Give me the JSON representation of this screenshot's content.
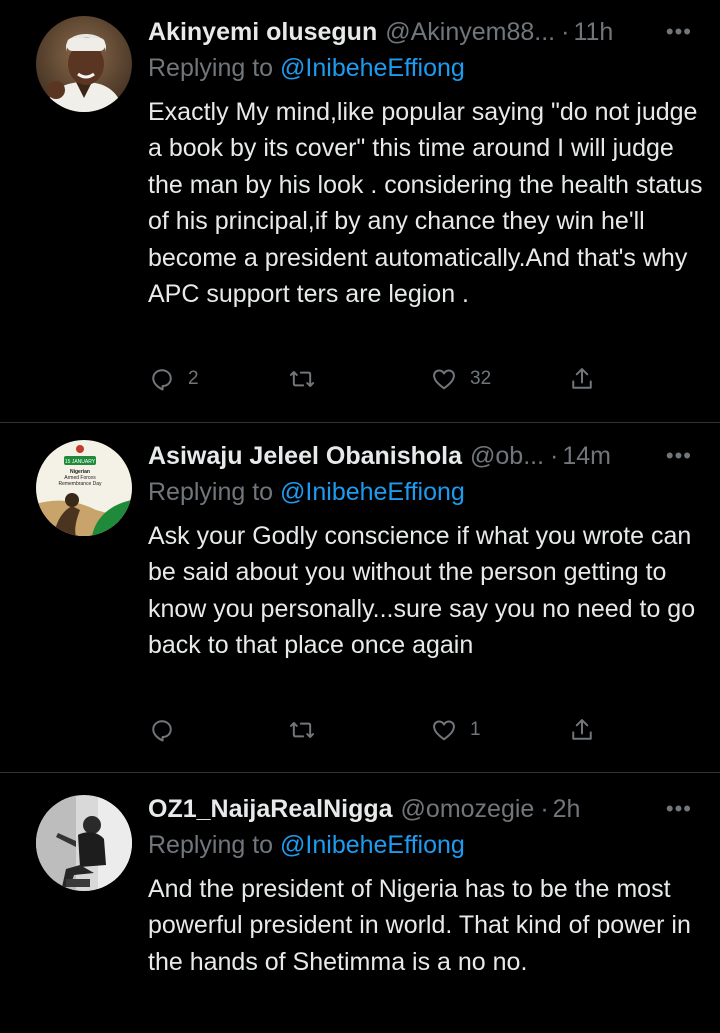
{
  "colors": {
    "background": "#000000",
    "text": "#e7e9ea",
    "muted": "#71767b",
    "link": "#1d9bf0",
    "divider": "#2f3336"
  },
  "tweets": [
    {
      "name": "Akinyemi olusegun",
      "handle": "@Akinyem88...",
      "separator": "·",
      "time": "11h",
      "replying_prefix": "Replying to",
      "replying_to": "@InibeheEffiong",
      "text": "Exactly My mind,like popular saying \"do not judge a book by its cover\" this time around I will judge the man by his look . considering the health status of his principal,if by any chance they win he'll become a president automatically.And that's why APC support ters are legion .",
      "replies": "2",
      "retweets": "",
      "likes": "32",
      "avatar_icon": "avatar-man-white-cap"
    },
    {
      "name": "Asiwaju Jeleel Obanishola",
      "handle": "@ob...",
      "separator": "·",
      "time": "14m",
      "replying_prefix": "Replying to",
      "replying_to": "@InibeheEffiong",
      "text": "Ask your Godly conscience if what you wrote can be said about you without the person getting to know you personally...sure say you no need to go back to that place once again",
      "replies": "",
      "retweets": "",
      "likes": "1",
      "avatar_icon": "avatar-remembrance-day-badge",
      "avatar_text": [
        "15 JANUARY",
        "Nigerian",
        "Armed Forces",
        "Remembrance Day"
      ]
    },
    {
      "name": "OZ1_NaijaRealNigga",
      "handle": "@omozegie",
      "separator": "·",
      "time": "2h",
      "replying_prefix": "Replying to",
      "replying_to": "@InibeheEffiong",
      "text": "And the president of Nigeria has to be the most powerful president in world. That kind of power in the hands of Shetimma is a no no.",
      "avatar_icon": "avatar-man-seated-photo"
    }
  ],
  "icons": {
    "more": "more-horizontal-icon",
    "reply": "reply-bubble-icon",
    "retweet": "retweet-arrows-icon",
    "like": "heart-outline-icon",
    "share": "share-upload-icon"
  }
}
